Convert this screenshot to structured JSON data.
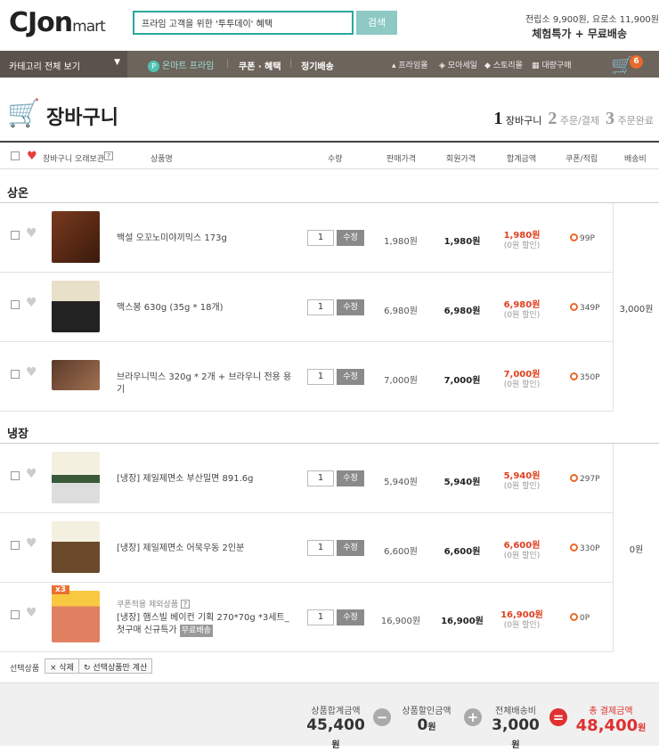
{
  "header": {
    "logo_text": "CJon",
    "logo_sub": "mart",
    "search_value": "프라임 고객을 위한 '투투데이' 혜택",
    "search_button": "검색",
    "promo_line1": "전립소 9,900원, 요로소 11,900원",
    "promo_line2": "체험특가 + 무료배송"
  },
  "nav": {
    "category": "카테고리 전체 보기",
    "onmart_prime": "온마트 프라임",
    "coupon": "쿠폰 · 혜택",
    "regular": "정기배송",
    "links": [
      "프라임몰",
      "모아세일",
      "스토리몰",
      "대량구매"
    ],
    "cart_count": "6"
  },
  "page": {
    "title": "장바구니",
    "steps": [
      {
        "num": "1",
        "label": "장바구니"
      },
      {
        "num": "2",
        "label": "주문/결제"
      },
      {
        "num": "3",
        "label": "주문완료"
      }
    ]
  },
  "table_header": {
    "keep": "장바구니 오래보관",
    "product": "상품명",
    "qty": "수량",
    "price": "판매가격",
    "member_price": "회원가격",
    "total": "합계금액",
    "coupon": "쿠폰/적립",
    "shipping": "배송비"
  },
  "groups": [
    {
      "title": "상온",
      "shipping": "3,000원",
      "items": [
        {
          "name": "백설 오꼬노미야끼믹스 173g",
          "qty": "1",
          "price": "1,980원",
          "member_price": "1,980원",
          "total": "1,980원",
          "discount": "(0원 할인)",
          "point": "99P"
        },
        {
          "name": "맥스봉 630g (35g * 18개)",
          "qty": "1",
          "price": "6,980원",
          "member_price": "6,980원",
          "total": "6,980원",
          "discount": "(0원 할인)",
          "point": "349P"
        },
        {
          "name": "브라우니믹스 320g * 2개 + 브라우니 전용 용기",
          "qty": "1",
          "price": "7,000원",
          "member_price": "7,000원",
          "total": "7,000원",
          "discount": "(0원 할인)",
          "point": "350P"
        }
      ]
    },
    {
      "title": "냉장",
      "shipping": "0원",
      "items": [
        {
          "name": "[냉장] 제일제면소 부산밀면 891.6g",
          "qty": "1",
          "price": "5,940원",
          "member_price": "5,940원",
          "total": "5,940원",
          "discount": "(0원 할인)",
          "point": "297P"
        },
        {
          "name": "[냉장] 제일제면소 어묵우동 2인분",
          "qty": "1",
          "price": "6,600원",
          "member_price": "6,600원",
          "total": "6,600원",
          "discount": "(0원 할인)",
          "point": "330P"
        },
        {
          "name": "[냉장] 햄스빌 베이컨 기획 270*70g *3세트_첫구매 신규특가",
          "note": "쿠폰적용 제외상품",
          "tag": "무료배송",
          "badge": "x3",
          "qty": "1",
          "price": "16,900원",
          "member_price": "16,900원",
          "total": "16,900원",
          "discount": "(0원 할인)",
          "point": "0P"
        }
      ]
    }
  ],
  "modify_label": "수정",
  "selection": {
    "label": "선택상품",
    "delete": "× 삭제",
    "calc": "선택상품만 계산"
  },
  "summary": {
    "product_total_label": "상품합계금액",
    "product_total": "45,400",
    "discount_label": "상품할인금액",
    "discount": "0",
    "shipping_label": "전체배송비",
    "shipping": "3,000",
    "grand_label": "총 결제금액",
    "grand_total": "48,400",
    "currency": "원"
  }
}
